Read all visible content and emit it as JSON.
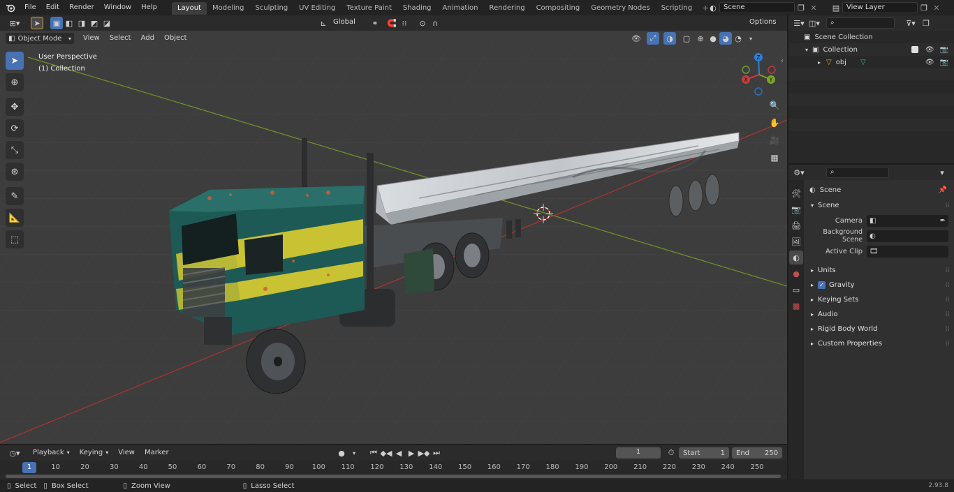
{
  "topbar": {
    "menus": [
      "File",
      "Edit",
      "Render",
      "Window",
      "Help"
    ],
    "workspaces": [
      "Layout",
      "Modeling",
      "Sculpting",
      "UV Editing",
      "Texture Paint",
      "Shading",
      "Animation",
      "Rendering",
      "Compositing",
      "Geometry Nodes",
      "Scripting"
    ],
    "active_workspace": "Layout",
    "scene": "Scene",
    "view_layer": "View Layer"
  },
  "viewport_header": {
    "mode": "Object Mode",
    "menus": [
      "View",
      "Select",
      "Add",
      "Object"
    ],
    "orientation": "Global",
    "options": "Options"
  },
  "viewport": {
    "overlay_title": "User Perspective",
    "overlay_collection": "(1) Collection",
    "gizmo_axes": {
      "z": "Z",
      "y": "Y",
      "x": "X"
    }
  },
  "outliner": {
    "search_placeholder": "",
    "scene_collection": "Scene Collection",
    "collection": "Collection",
    "object": "obj"
  },
  "properties": {
    "context": "Scene",
    "panel_scene": "Scene",
    "fields": {
      "camera_label": "Camera",
      "background_scene_label": "Background Scene",
      "active_clip_label": "Active Clip"
    },
    "subpanels": [
      "Units",
      "Gravity",
      "Keying Sets",
      "Audio",
      "Rigid Body World",
      "Custom Properties"
    ],
    "gravity_checked": true
  },
  "timeline": {
    "menus": [
      "Playback",
      "Keying",
      "View",
      "Marker"
    ],
    "current_frame": "1",
    "start_label": "Start",
    "start": "1",
    "end_label": "End",
    "end": "250",
    "ticks": [
      "1",
      "10",
      "20",
      "30",
      "40",
      "50",
      "60",
      "70",
      "80",
      "90",
      "100",
      "110",
      "120",
      "130",
      "140",
      "150",
      "160",
      "170",
      "180",
      "190",
      "200",
      "210",
      "220",
      "230",
      "240",
      "250"
    ],
    "playhead_frame": "1"
  },
  "statusbar": {
    "select": "Select",
    "box_select": "Box Select",
    "zoom_view": "Zoom View",
    "lasso_select": "Lasso Select",
    "version": "2.93.8"
  },
  "colors": {
    "accent": "#4772b3",
    "x_axis": "#c83c3c",
    "y_axis": "#7aa42a",
    "z_axis": "#2f7fd6"
  }
}
